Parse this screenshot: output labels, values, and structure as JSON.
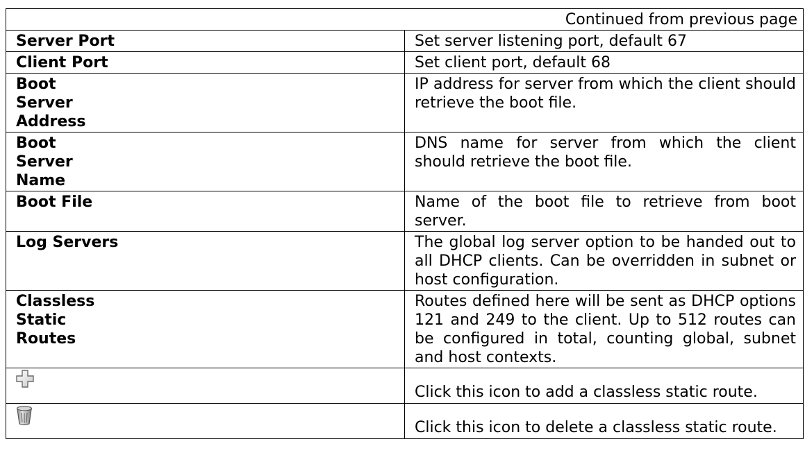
{
  "continued": "Continued from previous page",
  "rows": [
    {
      "name": "Server Port",
      "desc": "Set server listening port, default 67"
    },
    {
      "name": "Client Port",
      "desc": "Set client port, default 68"
    },
    {
      "name": "Boot Server Address",
      "desc": "IP address for server from which the client should retrieve the boot file."
    },
    {
      "name": "Boot Server Name",
      "desc": "DNS name for server from which the client should retrieve the boot file."
    },
    {
      "name": "Boot File",
      "desc": "Name of the boot file to retrieve from boot server."
    },
    {
      "name": "Log Servers",
      "desc": "The global log server option to be handed out to all DHCP clients. Can be overridden in subnet or host configuration."
    },
    {
      "name": "Classless Static Routes",
      "desc": "Routes defined here will be sent as DHCP options 121 and 249 to the client.  Up to 512 routes can be configured in total, counting global, subnet and host contexts."
    }
  ],
  "icon_rows": [
    {
      "icon": "plus-icon",
      "desc": "Click this icon to add a classless static route."
    },
    {
      "icon": "trash-icon",
      "desc": "Click this icon to delete a classless static route."
    }
  ]
}
